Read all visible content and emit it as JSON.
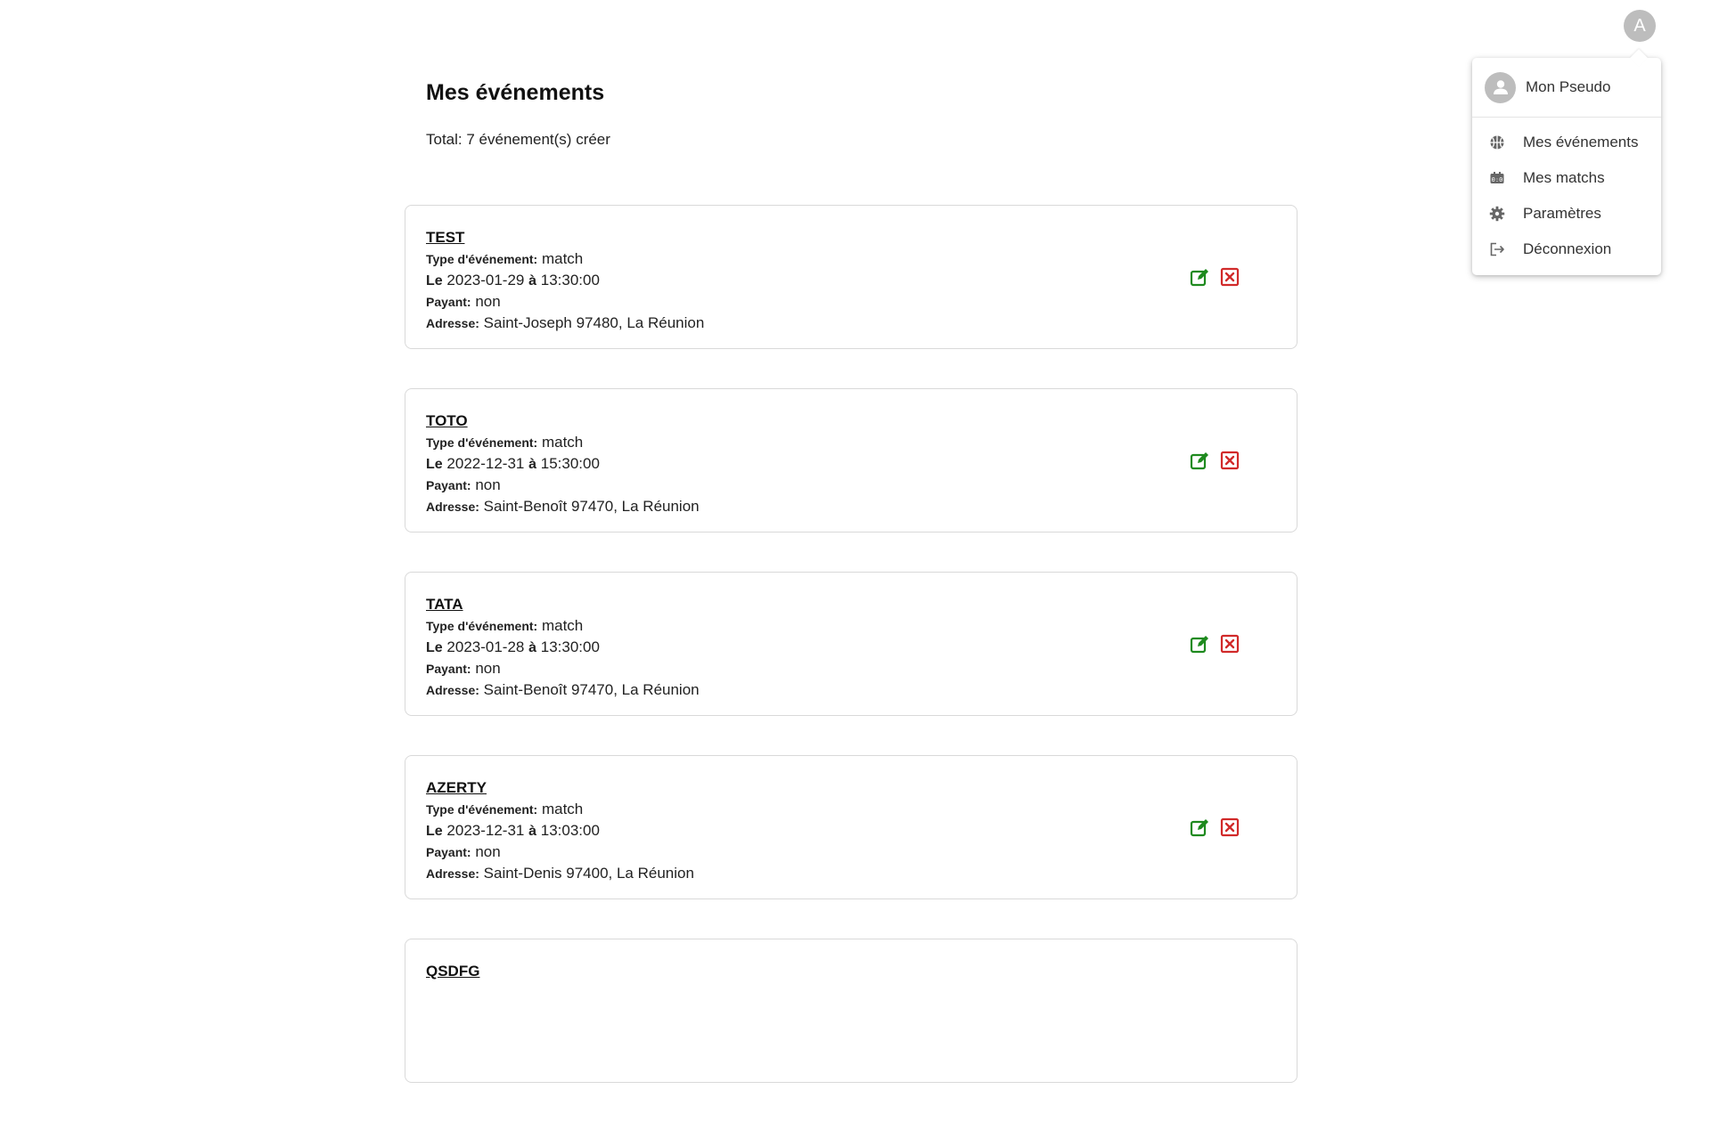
{
  "header": {
    "avatar_letter": "A"
  },
  "page": {
    "title": "Mes événements",
    "total": "Total: 7 événement(s) créer"
  },
  "labels": {
    "type": "Type d'événement:",
    "date_prefix": "Le",
    "time_sep": "à",
    "payant": "Payant:",
    "adresse": "Adresse:"
  },
  "events": [
    {
      "title": "TEST",
      "type": "match",
      "date": "2023-01-29",
      "time": "13:30:00",
      "payant": "non",
      "adresse": "Saint-Joseph 97480, La Réunion"
    },
    {
      "title": "TOTO",
      "type": "match",
      "date": "2022-12-31",
      "time": "15:30:00",
      "payant": "non",
      "adresse": "Saint-Benoît 97470, La Réunion"
    },
    {
      "title": "TATA",
      "type": "match",
      "date": "2023-01-28",
      "time": "13:30:00",
      "payant": "non",
      "adresse": "Saint-Benoît 97470, La Réunion"
    },
    {
      "title": "AZERTY",
      "type": "match",
      "date": "2023-12-31",
      "time": "13:03:00",
      "payant": "non",
      "adresse": "Saint-Denis 97400, La Réunion"
    },
    {
      "title": "QSDFG",
      "type": "",
      "date": "",
      "time": "",
      "payant": "",
      "adresse": ""
    }
  ],
  "icons": {
    "edit": "edit-icon",
    "delete": "delete-icon"
  },
  "colors": {
    "edit": "#1e8a1e",
    "delete": "#d12a2a"
  },
  "menu": {
    "profile_label": "Mon Pseudo",
    "items": [
      {
        "label": "Mes événements",
        "icon": "basketball-icon"
      },
      {
        "label": "Mes matchs",
        "icon": "scoreboard-icon"
      },
      {
        "label": "Paramètres",
        "icon": "gear-icon"
      },
      {
        "label": "Déconnexion",
        "icon": "logout-icon"
      }
    ]
  }
}
